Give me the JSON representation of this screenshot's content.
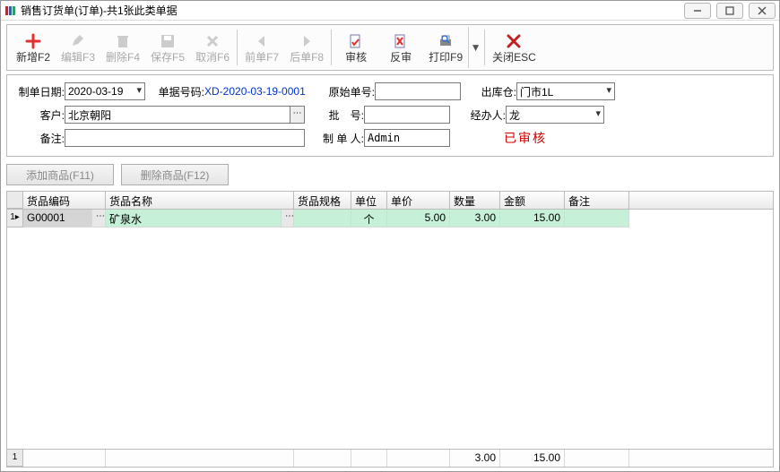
{
  "window": {
    "title": "销售订货单(订单)-共1张此类单据"
  },
  "toolbar": {
    "new": "新增F2",
    "edit": "编辑F3",
    "delete": "删除F4",
    "save": "保存F5",
    "cancel": "取消F6",
    "prev": "前单F7",
    "next": "后单F8",
    "audit": "审核",
    "unaudit": "反审",
    "print": "打印F9",
    "close": "关闭ESC"
  },
  "form": {
    "labels": {
      "date": "制单日期:",
      "billno": "单据号码:",
      "origno": "原始单号:",
      "warehouse": "出库仓:",
      "customer": "客户:",
      "batch": "批　号:",
      "handler": "经办人:",
      "remark": "备注:",
      "maker": "制 单 人:"
    },
    "date": "2020-03-19",
    "billno": "XD-2020-03-19-0001",
    "origno": "",
    "warehouse": "门市1L",
    "customer": "北京朝阳",
    "batch": "",
    "handler": "龙",
    "remark": "",
    "maker": "Admin",
    "status": "已审核"
  },
  "actions": {
    "addItem": "添加商品(F11)",
    "delItem": "删除商品(F12)"
  },
  "grid": {
    "headers": {
      "code": "货品编码",
      "name": "货品名称",
      "spec": "货品规格",
      "unit": "单位",
      "price": "单价",
      "qty": "数量",
      "amount": "金额",
      "remark": "备注"
    },
    "rows": [
      {
        "idx": "1",
        "code": "G00001",
        "name": "矿泉水",
        "spec": "",
        "unit": "个",
        "price": "5.00",
        "qty": "3.00",
        "amount": "15.00",
        "remark": ""
      }
    ],
    "footer": {
      "idx": "1",
      "qty": "3.00",
      "amount": "15.00"
    }
  }
}
